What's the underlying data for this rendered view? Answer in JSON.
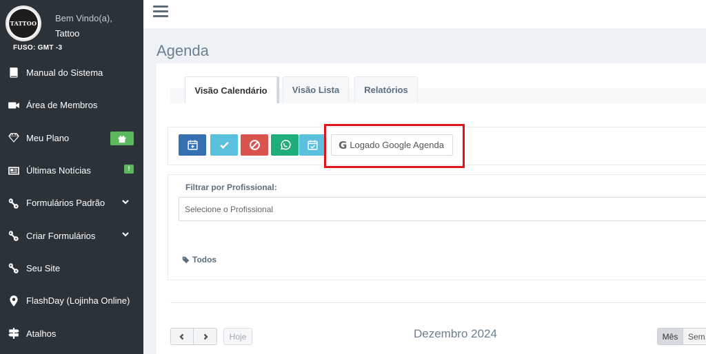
{
  "sidebar": {
    "logo_text": "TATTOO",
    "welcome": "Bem Vindo(a),",
    "username": "Tattoo",
    "timezone": "FUSO: GMT -3",
    "items": [
      {
        "label": "Manual do Sistema",
        "icon": "book-icon"
      },
      {
        "label": "Área de Membros",
        "icon": "video-camera-icon"
      },
      {
        "label": "Meu Plano",
        "icon": "diamond-icon",
        "badge_icon": "gift-icon"
      },
      {
        "label": "Últimas Notícias",
        "icon": "newspaper-icon",
        "badge": "!"
      },
      {
        "label": "Formulários Padrão",
        "icon": "link-icon",
        "has_submenu": true
      },
      {
        "label": "Criar Formulários",
        "icon": "link-icon",
        "has_submenu": true
      },
      {
        "label": "Seu Site",
        "icon": "link-icon"
      },
      {
        "label": "FlashDay (Lojinha Online)",
        "icon": "map-marker-icon"
      },
      {
        "label": "Atalhos",
        "icon": "signpost-icon"
      }
    ]
  },
  "header": {
    "menu_icon": "hamburger-icon"
  },
  "page": {
    "title": "Agenda"
  },
  "tabs": [
    {
      "label": "Visão Calendário",
      "active": true
    },
    {
      "label": "Visão Lista",
      "active": false
    },
    {
      "label": "Relatórios",
      "active": false
    }
  ],
  "toolbar": {
    "buttons": [
      {
        "icon": "calendar-plus-icon",
        "color": "#3670b2"
      },
      {
        "icon": "check-icon",
        "color": "#5bc0de"
      },
      {
        "icon": "ban-icon",
        "color": "#d9534f"
      },
      {
        "icon": "whatsapp-icon",
        "color": "#1fae79"
      },
      {
        "icon": "calendar-check-icon",
        "color": "#5bc0de"
      }
    ],
    "google_label": "Logado Google Agenda",
    "google_icon": "google-icon"
  },
  "filter": {
    "label": "Filtrar por Profissional:",
    "placeholder": "Selecione o Profissional",
    "tag_all": "Todos"
  },
  "calendar": {
    "today_label": "Hoje",
    "month_title": "Dezembro 2024",
    "views": [
      "Mês",
      "Sem."
    ]
  }
}
